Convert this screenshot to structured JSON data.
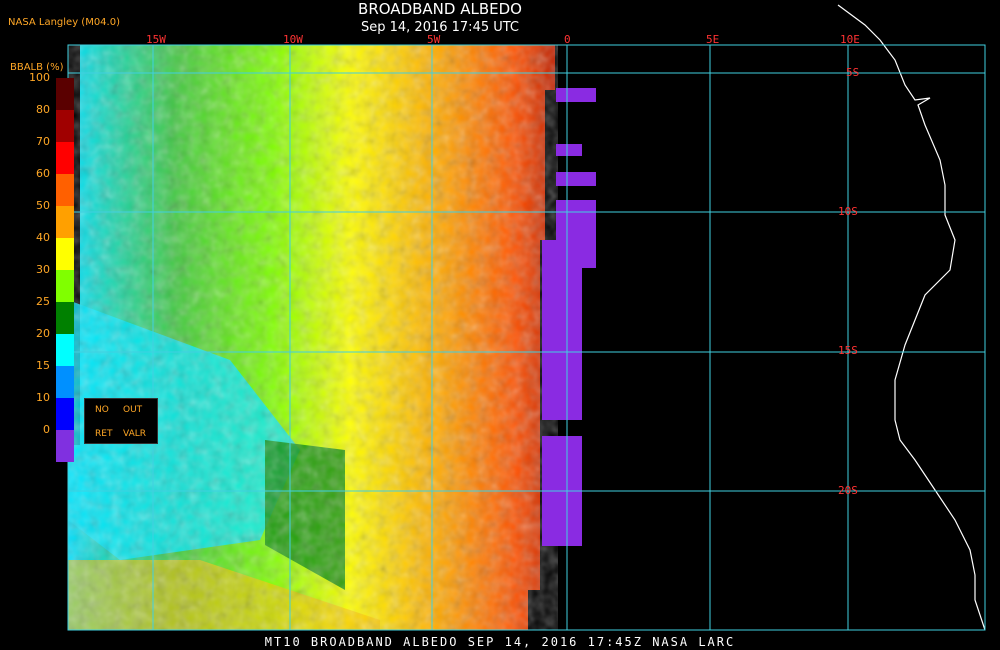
{
  "header": {
    "producer": "NASA Langley (M04.0)",
    "title": "BROADBAND ALBEDO",
    "subtitle": "Sep 14, 2016 17:45 UTC"
  },
  "grid": {
    "lon_labels": [
      "15W",
      "10W",
      "5W",
      "0",
      "5E",
      "10E"
    ],
    "lat_labels": [
      "5S",
      "10S",
      "15S",
      "20S"
    ],
    "line_color": "#40d0e0"
  },
  "colorbar": {
    "label": "BBALB (%)",
    "ticks": [
      "100",
      "80",
      "70",
      "60",
      "50",
      "40",
      "30",
      "25",
      "20",
      "15",
      "10",
      "0"
    ],
    "colors": [
      "#5a0000",
      "#a00000",
      "#ff0000",
      "#ff6000",
      "#ffa000",
      "#ffff00",
      "#80ff00",
      "#008000",
      "#00ffff",
      "#0090ff",
      "#0000ff",
      "#8030e0"
    ]
  },
  "legend": {
    "no": "NO",
    "out": "OUT",
    "ret": "RET",
    "valr": "VALR"
  },
  "footer": {
    "text": "MT10  BROADBAND ALBEDO  SEP 14, 2016 17:45Z  NASA LARC"
  },
  "colors": {
    "no_retrieval": "#8a2be2",
    "coastline": "#ffffff"
  }
}
